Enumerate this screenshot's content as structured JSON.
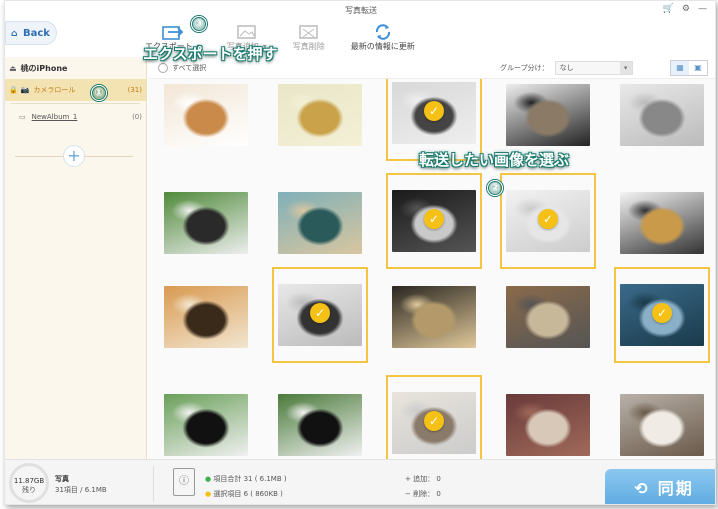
{
  "window_title": "写真転送",
  "back_label": "Back",
  "toolbar": {
    "export": "エクスポート",
    "add_photo": "写真追加",
    "delete_photo": "写真削除",
    "refresh": "最新の情報に更新"
  },
  "annotations": {
    "step1": "①",
    "step2": "②",
    "step3": "③",
    "export_hint": "エクスポートを押す",
    "select_hint": "転送したい画像を選ぶ"
  },
  "sidebar": {
    "device": "桃のiPhone",
    "items": [
      {
        "label": "カメラロール",
        "count": "(31)"
      },
      {
        "label": "NewAlbum_1",
        "count": "(0)"
      }
    ],
    "add": "+"
  },
  "subbar": {
    "select_all": "すべて選択",
    "group_label": "グループ分け：",
    "group_value": "なし"
  },
  "photos": [
    {
      "subject": "shiba-dog",
      "selected": false
    },
    {
      "subject": "golden-retriever-flowers",
      "selected": false
    },
    {
      "subject": "husky-puppies",
      "selected": true
    },
    {
      "subject": "wolf-pup",
      "selected": false
    },
    {
      "subject": "wolf-snow",
      "selected": false
    },
    {
      "subject": "husky-pair",
      "selected": false
    },
    {
      "subject": "sky-landscape",
      "selected": false
    },
    {
      "subject": "moon-night",
      "selected": true
    },
    {
      "subject": "arctic-fox",
      "selected": true
    },
    {
      "subject": "leopard-cub",
      "selected": false
    },
    {
      "subject": "tigers",
      "selected": false
    },
    {
      "subject": "white-tiger",
      "selected": true
    },
    {
      "subject": "lion",
      "selected": false
    },
    {
      "subject": "tabby-kitten",
      "selected": false
    },
    {
      "subject": "dolphin",
      "selected": true
    },
    {
      "subject": "panda",
      "selected": false
    },
    {
      "subject": "panda-tree",
      "selected": false
    },
    {
      "subject": "kittens-basket",
      "selected": true
    },
    {
      "subject": "kitten-flowers",
      "selected": false
    },
    {
      "subject": "ragdoll-kitten",
      "selected": false
    }
  ],
  "footer": {
    "free_space": "11.87GB",
    "free_label": "残り",
    "storage_type": "写真",
    "storage_detail": "31項目 / 6.1MB",
    "total_items": "項目合計 31 ( 6.1MB )",
    "selected_items": "選択項目 6 ( 860KB )",
    "add_count": "追加： 0",
    "delete_count": "削除： 0",
    "sync": "同期"
  },
  "colors": {
    "accent": "#f5c116",
    "annotation": "#1a7a6e",
    "link": "#2d6fb0"
  }
}
